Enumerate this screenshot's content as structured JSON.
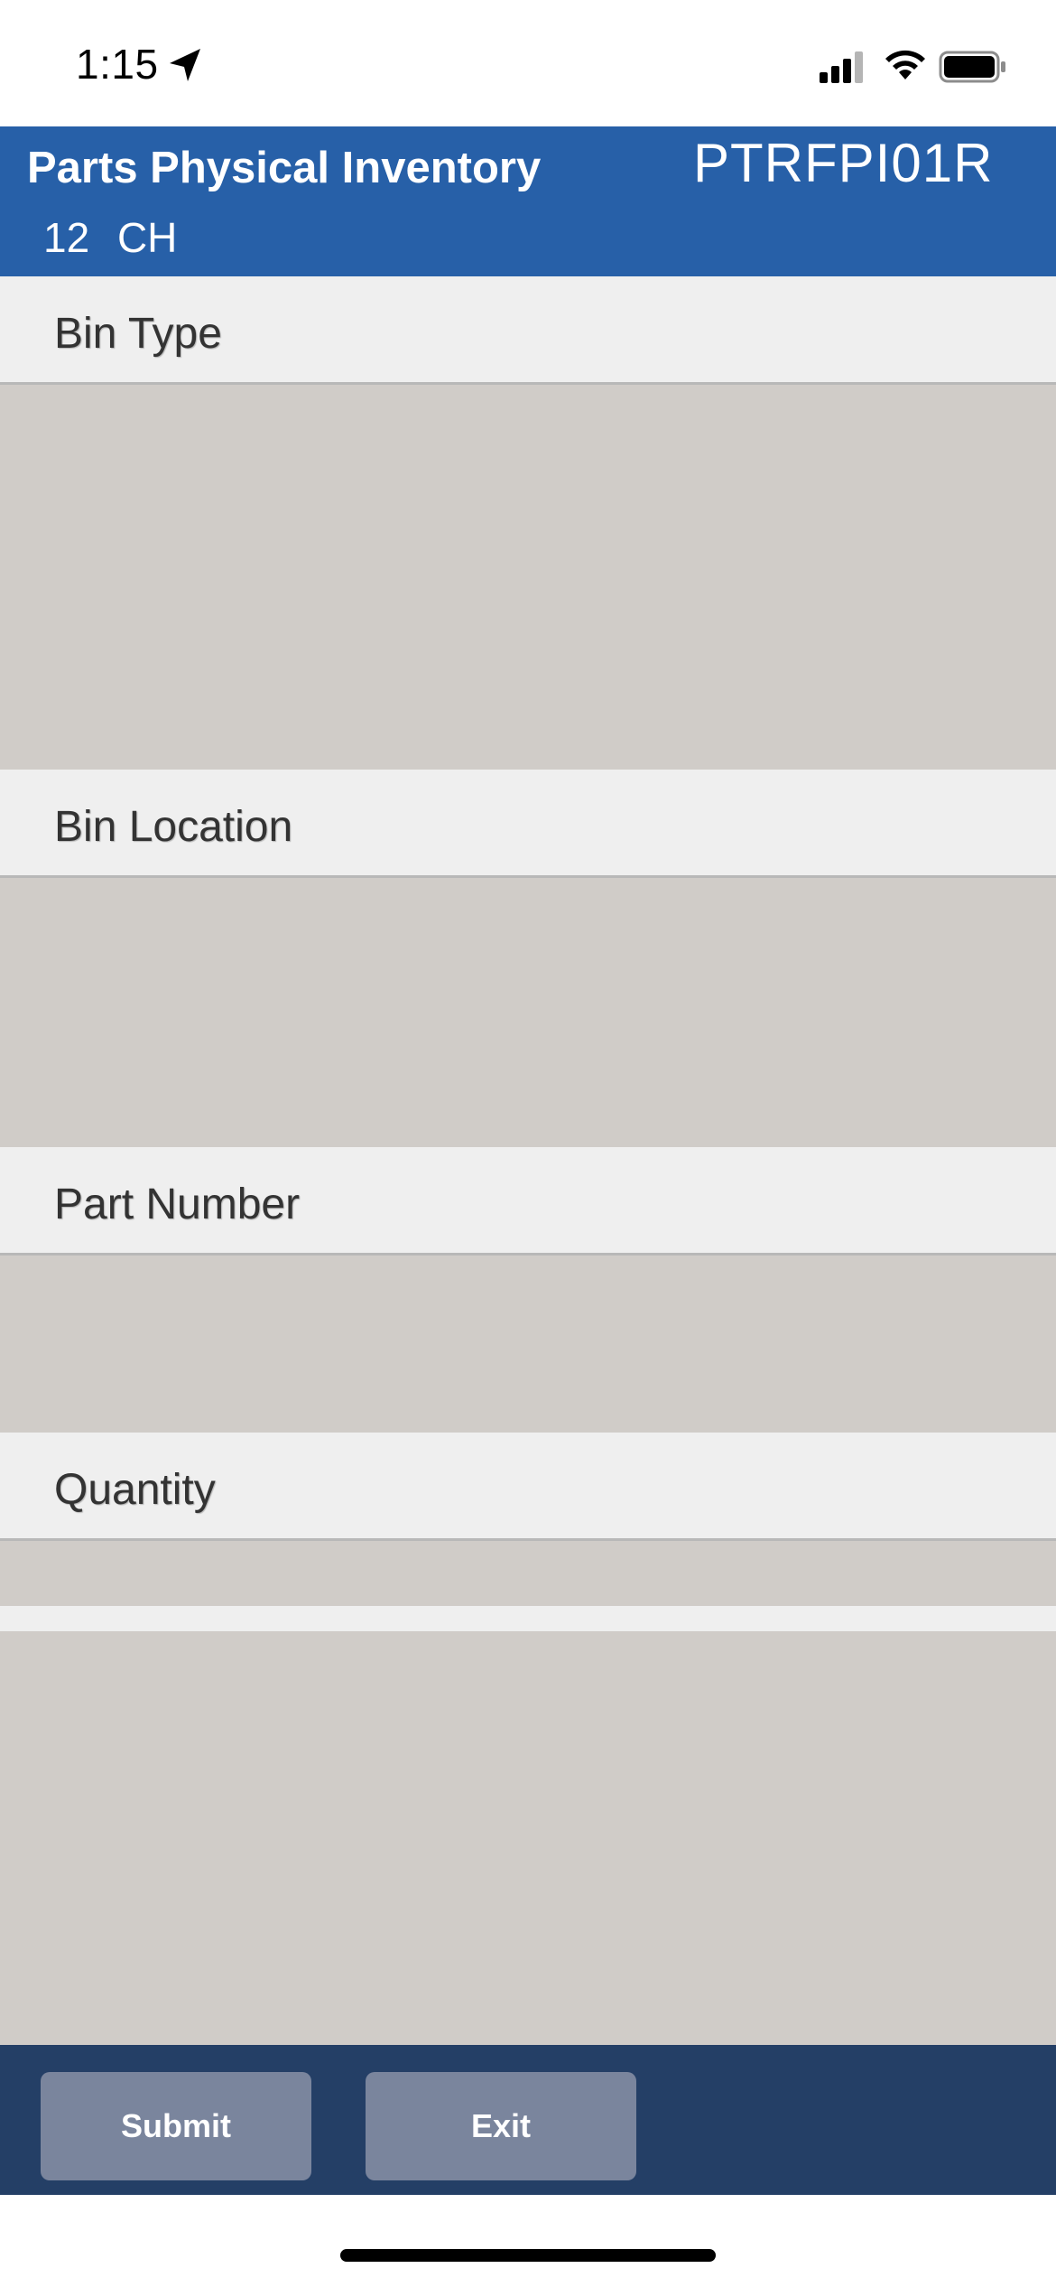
{
  "status_bar": {
    "time": "1:15",
    "icons": [
      "location-arrow-icon",
      "cellular-signal-icon",
      "wifi-icon",
      "battery-icon"
    ]
  },
  "header": {
    "title": "Parts Physical Inventory",
    "code": "PTRFPI01R",
    "subtitle": "12   CH"
  },
  "fields": [
    {
      "label": "Bin Type",
      "value": ""
    },
    {
      "label": "Bin Location",
      "value": ""
    },
    {
      "label": "Part Number",
      "value": ""
    },
    {
      "label": "Quantity",
      "value": ""
    }
  ],
  "footer": {
    "submit_label": "Submit",
    "exit_label": "Exit"
  },
  "colors": {
    "header_blue": "#2760a8",
    "footer_navy": "#243f66",
    "button_gray": "#7a859d",
    "field_gray": "#d0ccc8",
    "label_bg": "#efefef"
  }
}
